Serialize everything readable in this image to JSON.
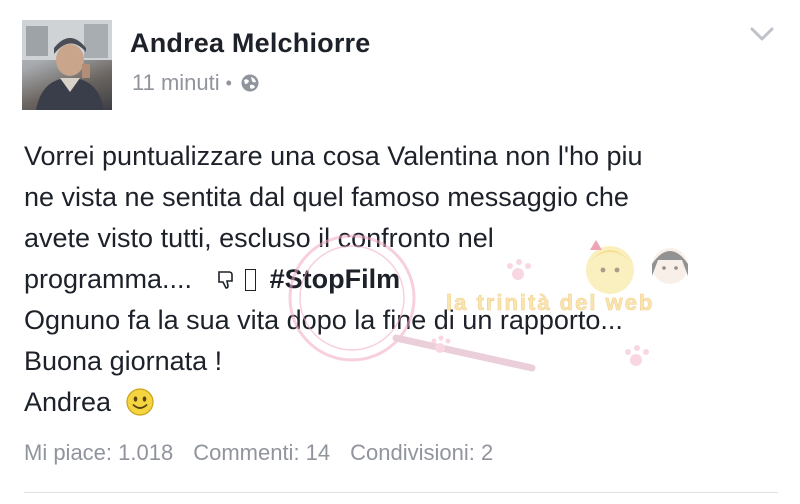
{
  "post": {
    "author": "Andrea Melchiorre",
    "time": "11 minuti",
    "separator": "•",
    "privacy_icon": "globe-icon",
    "menu_icon": "chevron-down-icon",
    "text_lines": [
      "Vorrei puntualizzare una cosa Valentina non l'ho piu",
      "ne vista ne sentita dal quel famoso messaggio che",
      "avete visto tutti, escluso il confronto nel",
      "programma....",
      "Ognuno fa la sua vita dopo la fine di un rapporto...",
      "Buona giornata !",
      "Andrea"
    ],
    "hashtag": "#StopFilm",
    "emoji_icon": "smiley-icon",
    "stats": {
      "likes": "Mi piace: 1.018",
      "comments": "Commenti: 14",
      "shares": "Condivisioni: 2"
    }
  },
  "watermark": {
    "text": "la trinità del web",
    "accent_color": "#f2a9c5"
  }
}
